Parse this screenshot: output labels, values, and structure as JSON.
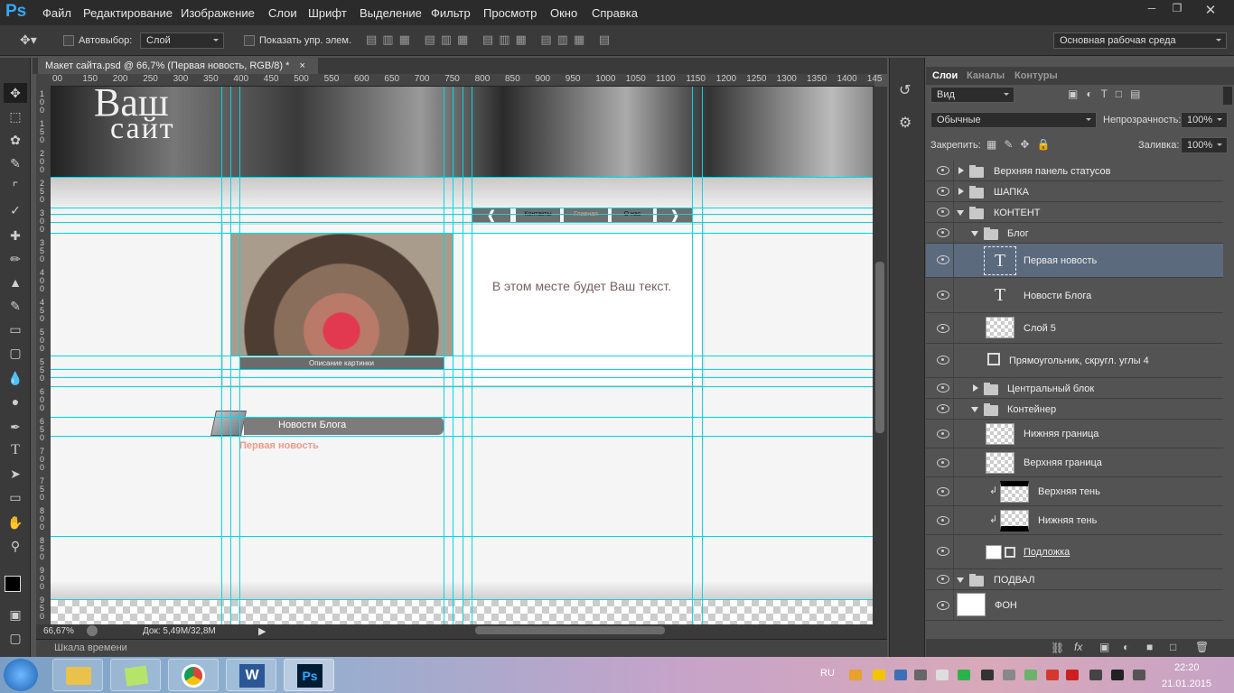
{
  "menubar": {
    "logo": "Ps",
    "items": [
      "Файл",
      "Редактирование",
      "Изображение",
      "Слои",
      "Шрифт",
      "Выделение",
      "Фильтр",
      "Просмотр",
      "Окно",
      "Справка"
    ]
  },
  "options": {
    "autoselect_label": "Автовыбор:",
    "autoselect_value": "Слой",
    "show_transform_label": "Показать упр. элем.",
    "workspace": "Основная рабочая среда"
  },
  "document": {
    "tab_title": "Макет сайта.psd @ 66,7% (Первая новость, RGB/8) *",
    "zoom": "66,67%",
    "doc_info": "Док: 5,49M/32,8M",
    "timeline_label": "Шкала времени"
  },
  "ruler": {
    "h_ticks": [
      "00",
      "150",
      "200",
      "250",
      "300",
      "350",
      "400",
      "450",
      "500",
      "550",
      "600",
      "650",
      "700",
      "750",
      "800",
      "850",
      "900",
      "950",
      "1000",
      "1050",
      "1100",
      "1150",
      "1200",
      "1250",
      "1300",
      "1350",
      "1400",
      "145"
    ],
    "v_ticks": [
      "1 0 0",
      "1 5 0",
      "2 0 0",
      "2 5 0",
      "3 0 0",
      "3 5 0",
      "4 0 0",
      "4 5 0",
      "5 0 0",
      "5 5 0",
      "6 0 0",
      "6 5 0",
      "7 0 0",
      "7 5 0",
      "8 0 0",
      "8 5 0",
      "9 0 0",
      "9 5 0"
    ]
  },
  "canvas": {
    "header_line1": "Ваш",
    "header_line2": "сайт",
    "nav": [
      "Контакты",
      "Главная",
      "О нас"
    ],
    "picture_caption": "Описание картинки",
    "placeholder": "В этом месте будет Ваш текст.",
    "news_heading": "Новости Блога",
    "first_news": "Первая новость"
  },
  "layers_panel": {
    "tabs": [
      "Слои",
      "Каналы",
      "Контуры"
    ],
    "filter_kind": "Вид",
    "blend_mode": "Обычные",
    "opacity_label": "Непрозрачность:",
    "opacity": "100%",
    "lock_label": "Закрепить:",
    "fill_label": "Заливка:",
    "fill": "100%",
    "layers": [
      {
        "name": "Верхняя панель статусов",
        "type": "group",
        "expanded": false,
        "indent": 0
      },
      {
        "name": "ШАПКА",
        "type": "group",
        "expanded": false,
        "indent": 0
      },
      {
        "name": "КОНТЕНТ",
        "type": "group",
        "expanded": true,
        "indent": 0
      },
      {
        "name": "Блог",
        "type": "group",
        "expanded": true,
        "indent": 1
      },
      {
        "name": "Первая новость",
        "type": "text",
        "selected": true
      },
      {
        "name": "Новости Блога",
        "type": "text"
      },
      {
        "name": "Слой 5",
        "type": "pixel"
      },
      {
        "name": "Прямоугольник, скругл. углы 4",
        "type": "shape"
      },
      {
        "name": "Центральный блок",
        "type": "group",
        "expanded": false,
        "indent": 1
      },
      {
        "name": "Контейнер",
        "type": "group",
        "expanded": true,
        "indent": 1
      },
      {
        "name": "Нижняя граница",
        "type": "pixel"
      },
      {
        "name": "Верхняя граница",
        "type": "pixel"
      },
      {
        "name": "Верхняя тень",
        "type": "clip"
      },
      {
        "name": "Нижняя тень",
        "type": "clip"
      },
      {
        "name": "Подложка",
        "type": "shape"
      },
      {
        "name": "ПОДВАЛ",
        "type": "group",
        "expanded": true,
        "indent": 0
      },
      {
        "name": "ФОН",
        "type": "background"
      }
    ]
  },
  "taskbar": {
    "lang": "RU",
    "time": "22:20",
    "date": "21.01.2015"
  },
  "colors": {
    "guide": "#00d9e8",
    "selected_layer": "#5c6a7e",
    "accent_text": "#ee9a87"
  }
}
